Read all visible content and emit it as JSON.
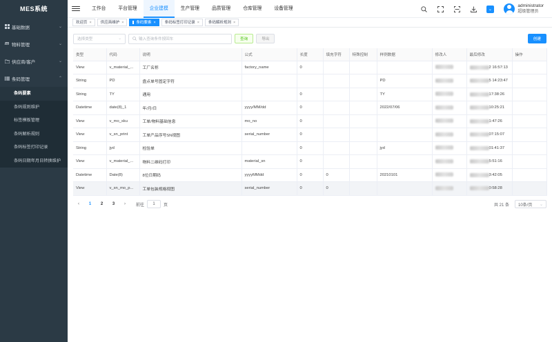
{
  "app": {
    "title": "MES系统"
  },
  "sidebar": {
    "items": [
      {
        "label": "基础数据",
        "icon": "grid-icon"
      },
      {
        "label": "物料管理",
        "icon": "m-icon"
      },
      {
        "label": "供应商/客户",
        "icon": "folder-icon"
      },
      {
        "label": "条码管理",
        "icon": "barcode-icon"
      }
    ],
    "submenu": [
      "条码要素",
      "条码规则维护",
      "标签模板管理",
      "条码解析规则",
      "条码标签打印记录",
      "条码日期年月日转换维护"
    ],
    "active_sub": "条码要素"
  },
  "header": {
    "nav": [
      "工作台",
      "平台管理",
      "企业建模",
      "生产管理",
      "品质管理",
      "仓库管理",
      "设备管理"
    ],
    "active_nav": "企业建模",
    "user": {
      "name": "administrator",
      "role": "超级管理员"
    }
  },
  "tabs": [
    {
      "label": "欢迎页",
      "active": false
    },
    {
      "label": "供应商维护",
      "active": false
    },
    {
      "label": "条码要素",
      "active": true
    },
    {
      "label": "条码标签打印记录",
      "active": false
    },
    {
      "label": "条码解析规则",
      "active": false
    }
  ],
  "toolbar": {
    "select_placeholder": "选择类型",
    "search_placeholder": "输入查询条件按回车",
    "query_label": "查询",
    "export_label": "导出",
    "create_label": "创建"
  },
  "table": {
    "columns": [
      "类型",
      "代码",
      "说明",
      "公式",
      "长度",
      "填充字符",
      "特殊控制",
      "样例数据",
      "修改人",
      "最后修改",
      "操作"
    ],
    "rows": [
      [
        "View",
        "v_material_...",
        "工厂名称",
        "factory_name",
        "0",
        "",
        "",
        "",
        "",
        "2 16:57:13",
        ""
      ],
      [
        "String",
        "PD",
        "盘点单号固定字符",
        "",
        "",
        "",
        "",
        "PD",
        "",
        "5 14:23:47",
        ""
      ],
      [
        "String",
        "TY",
        "通用",
        "",
        "0",
        "",
        "",
        "TY",
        "",
        "17:38:26",
        ""
      ],
      [
        "Datetime",
        "date(8)_1",
        "年/月/日",
        "yyyy/MM/dd",
        "0",
        "",
        "",
        "2022/07/06",
        "",
        "10:25:21",
        ""
      ],
      [
        "View",
        "v_mo_sku",
        "工单/物料基础信息",
        "mo_no",
        "0",
        "",
        "",
        "",
        "",
        "1:47:26",
        ""
      ],
      [
        "View",
        "v_sn_print",
        "工单产品序号SN视图",
        "serial_number",
        "0",
        "",
        "",
        "",
        "",
        "07:15:07",
        ""
      ],
      [
        "String",
        "jyd",
        "检验单",
        "",
        "0",
        "",
        "",
        "jyd",
        "",
        "01:41:37",
        ""
      ],
      [
        "View",
        "v_material_...",
        "物料二维码打印",
        "material_sn",
        "0",
        "",
        "",
        "",
        "",
        "5:51:16",
        ""
      ],
      [
        "Datetime",
        "Date(8)",
        "8位日期码",
        "yyyyMMdd",
        "0",
        "0",
        "",
        "20210101",
        "",
        "3:42:05",
        ""
      ],
      [
        "View",
        "v_sn_mo_p...",
        "工单包装规格视图",
        "serial_number",
        "0",
        "0",
        "",
        "",
        "",
        "0:58:28",
        ""
      ]
    ]
  },
  "pagination": {
    "pages": [
      "1",
      "2",
      "3"
    ],
    "current": "1",
    "goto_label": "前往",
    "goto_value": "1",
    "page_suffix": "页",
    "total": "共 21 条",
    "page_size": "10条/页"
  }
}
